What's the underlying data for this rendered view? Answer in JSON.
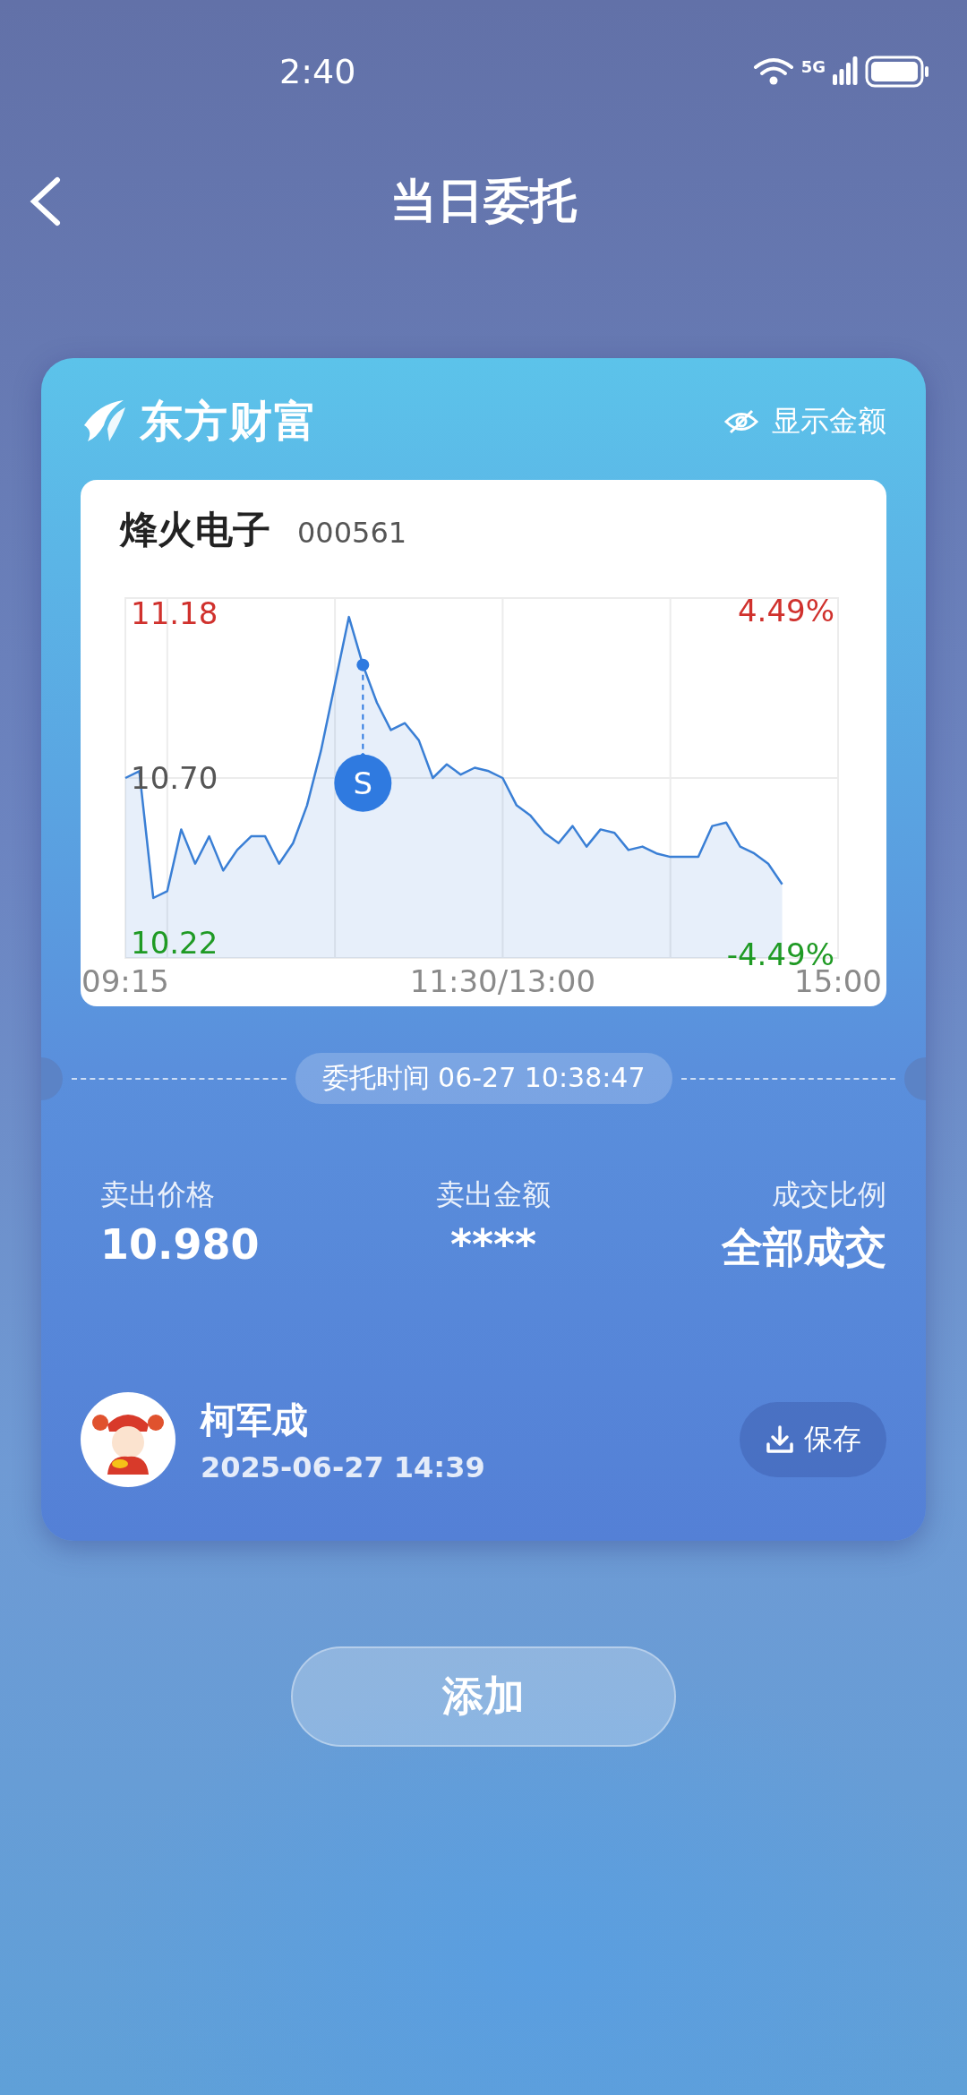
{
  "status_bar": {
    "time": "2:40",
    "network": "5G"
  },
  "header": {
    "title": "当日委托"
  },
  "card": {
    "brand": "东方财富",
    "show_amount": "显示金额",
    "stock": {
      "name": "烽火电子",
      "code": "000561",
      "chart_data": {
        "type": "area",
        "grid": true,
        "ylim": [
          10.175,
          11.225
        ],
        "yticks": [
          11.18,
          {
            "value": 10.7,
            "label": "10.70"
          },
          10.22
        ],
        "categories": [
          "09:15",
          null,
          null,
          null,
          null,
          null,
          null,
          null,
          null,
          null,
          null,
          null,
          null,
          null,
          null,
          null,
          null,
          null,
          null,
          null,
          null,
          null,
          null,
          null,
          null,
          null,
          null,
          "11:30/13:00",
          null,
          null,
          null,
          null,
          null,
          null,
          null,
          null,
          null,
          null,
          null,
          null,
          null,
          null,
          null,
          null,
          null,
          null,
          null,
          null,
          null,
          null,
          null,
          "15:00"
        ],
        "series": [
          {
            "color": "#3a7fd5",
            "values": [
              10.7,
              10.72,
              10.35,
              10.37,
              10.55,
              10.45,
              10.53,
              10.43,
              10.49,
              10.53,
              10.53,
              10.45,
              10.51,
              10.62,
              10.78,
              null,
              11.17,
              11.03,
              10.92,
              10.84,
              10.86,
              10.81,
              10.7,
              10.74,
              10.71,
              10.73,
              10.72,
              10.7,
              10.62,
              10.59,
              10.54,
              10.51,
              10.56,
              10.5,
              10.55,
              10.54,
              10.49,
              10.5,
              10.48,
              10.47,
              10.47,
              10.47,
              10.56,
              10.57,
              10.5,
              10.48,
              10.45,
              10.39,
              null,
              null,
              null,
              null
            ]
          }
        ],
        "annotations": [
          "4.49%",
          "-4.49%",
          {
            "text": "S",
            "y": 11.03
          }
        ]
      }
    },
    "order_time": "委托时间 06-27 10:38:47",
    "stats": [
      {
        "label": "卖出价格",
        "value": "10.980"
      },
      {
        "label": "卖出金额",
        "value": "****"
      },
      {
        "label": "成交比例",
        "value": "全部成交"
      }
    ],
    "user": {
      "name": "柯军成",
      "datetime": "2025-06-27 14:39"
    },
    "save_button": "保存"
  },
  "add_button": "添加"
}
